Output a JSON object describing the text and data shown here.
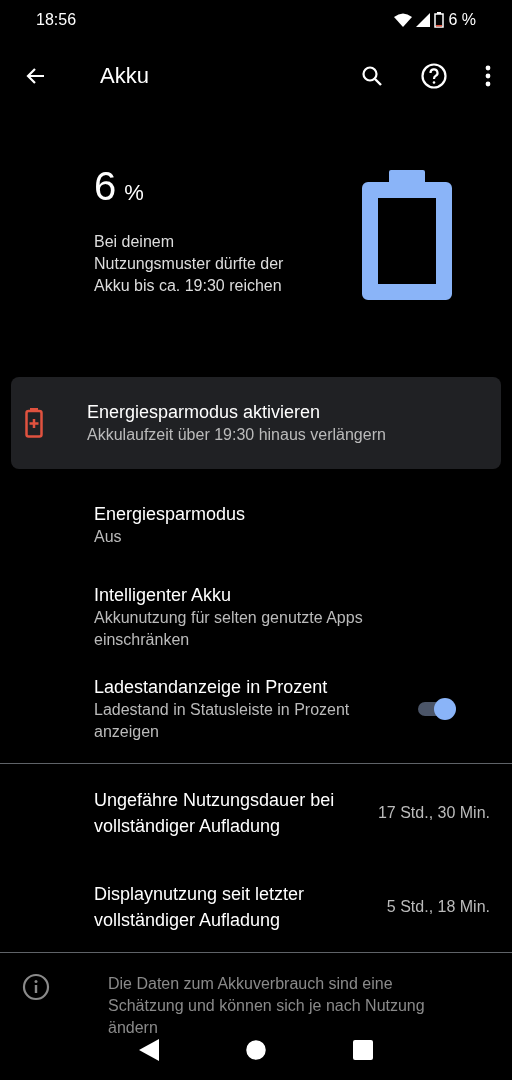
{
  "status_bar": {
    "time": "18:56",
    "battery_text": "6 %"
  },
  "toolbar": {
    "title": "Akku"
  },
  "summary": {
    "percent": "6",
    "unit": "%",
    "description": "Bei deinem Nutzungsmuster dürfte der Akku bis ca. 19:30 reichen"
  },
  "suggestion": {
    "title": "Energiesparmodus aktivieren",
    "subtitle": "Akkulaufzeit über 19:30 hinaus verlängern"
  },
  "settings": [
    {
      "kind": "text",
      "title": "Energiesparmodus",
      "subtitle": "Aus"
    },
    {
      "kind": "text",
      "title": "Intelligenter Akku",
      "subtitle": "Akkunutzung für selten genutzte Apps einschränken"
    },
    {
      "kind": "switch",
      "title": "Ladestandanzeige in Prozent",
      "subtitle": "Ladestand in Statusleiste in Prozent anzeigen",
      "on": true
    }
  ],
  "usage": [
    {
      "label": "Ungefähre Nutzungsdauer bei vollständiger Aufladung",
      "value": "17 Std., 30 Min."
    },
    {
      "label": "Displaynutzung seit letzter vollständiger Aufladung",
      "value": "5 Std., 18 Min."
    }
  ],
  "footer_note": "Die Daten zum Akkuverbrauch sind eine Schätzung und können sich je nach Nutzung ändern"
}
